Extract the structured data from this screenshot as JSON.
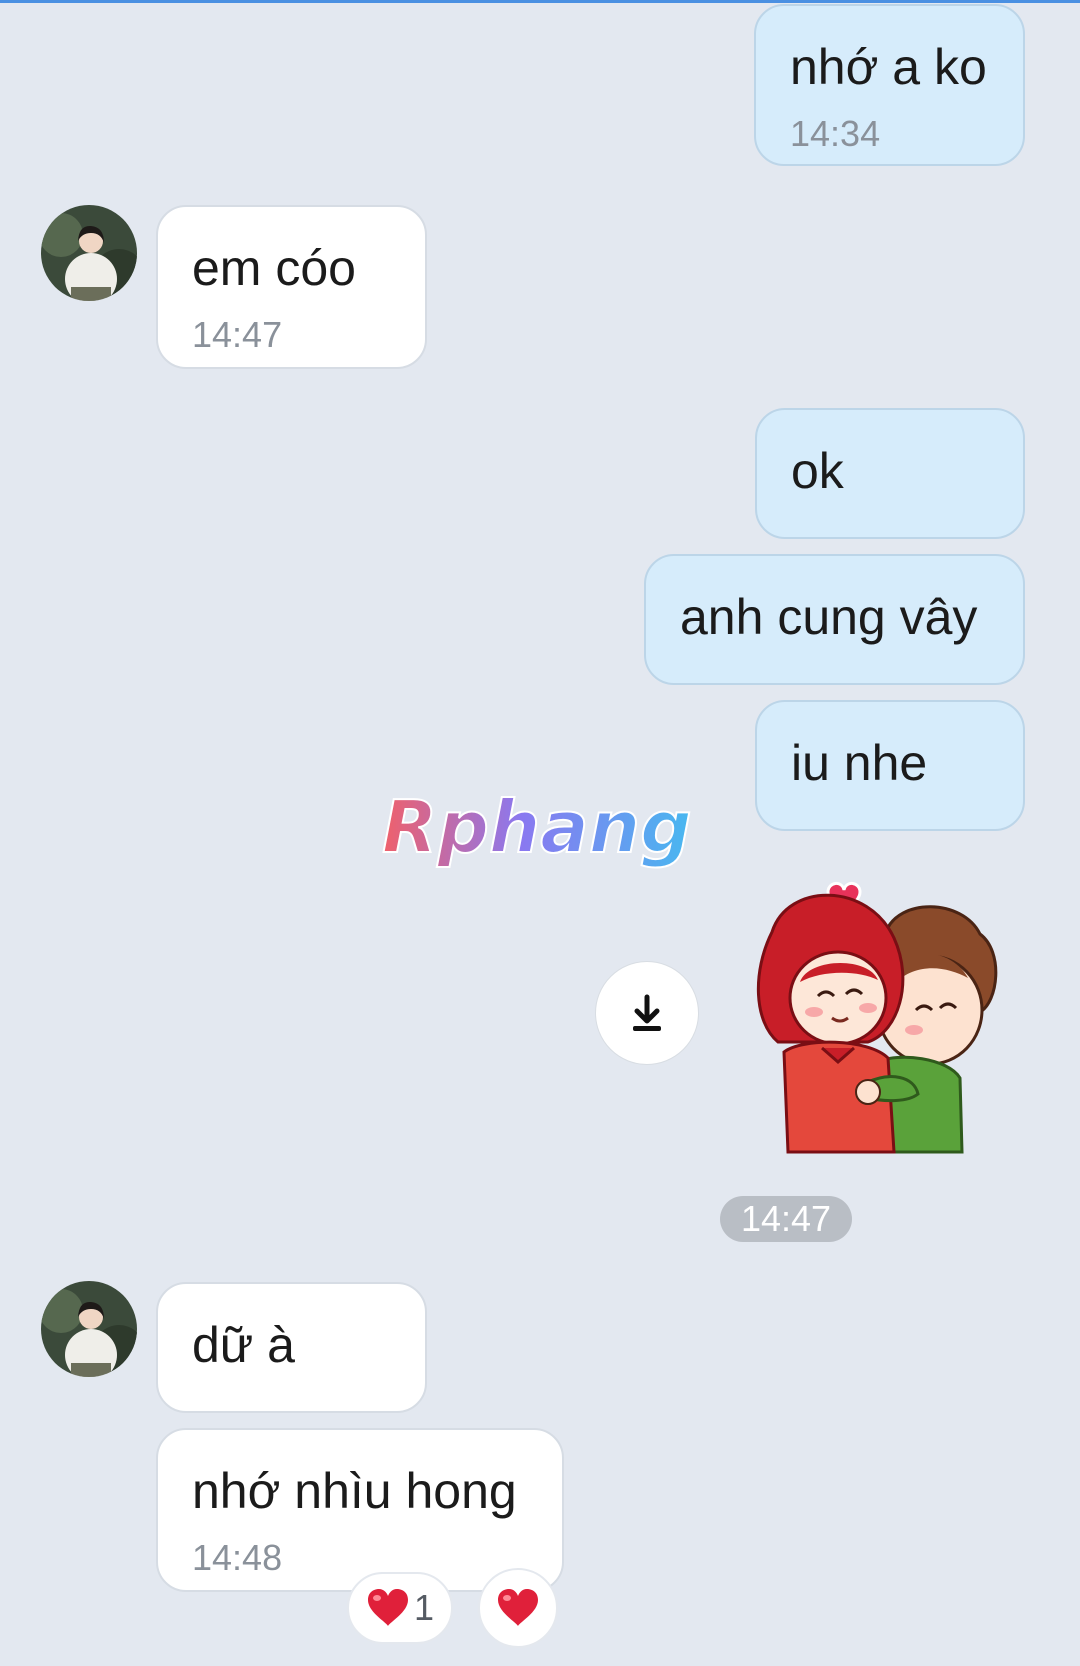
{
  "messages": [
    {
      "text": "nhớ a ko",
      "time": "14:34"
    },
    {
      "text": "em cóo",
      "time": "14:47"
    },
    {
      "text": "ok"
    },
    {
      "text": "anh cung vây"
    },
    {
      "text": "iu nhe"
    },
    {
      "text": "dữ à"
    },
    {
      "text": "nhớ nhìu hong",
      "time": "14:48"
    }
  ],
  "sticker": {
    "time": "14:47"
  },
  "watermark": {
    "text": "Rphang"
  },
  "reactions": {
    "heart_count": "1"
  },
  "colors": {
    "background": "#e3e8f0",
    "outgoing_bubble": "#d6ecfb",
    "incoming_bubble": "#ffffff",
    "heart": "#e0203a"
  },
  "icons": {
    "download": "download-icon",
    "heart": "heart-icon"
  }
}
